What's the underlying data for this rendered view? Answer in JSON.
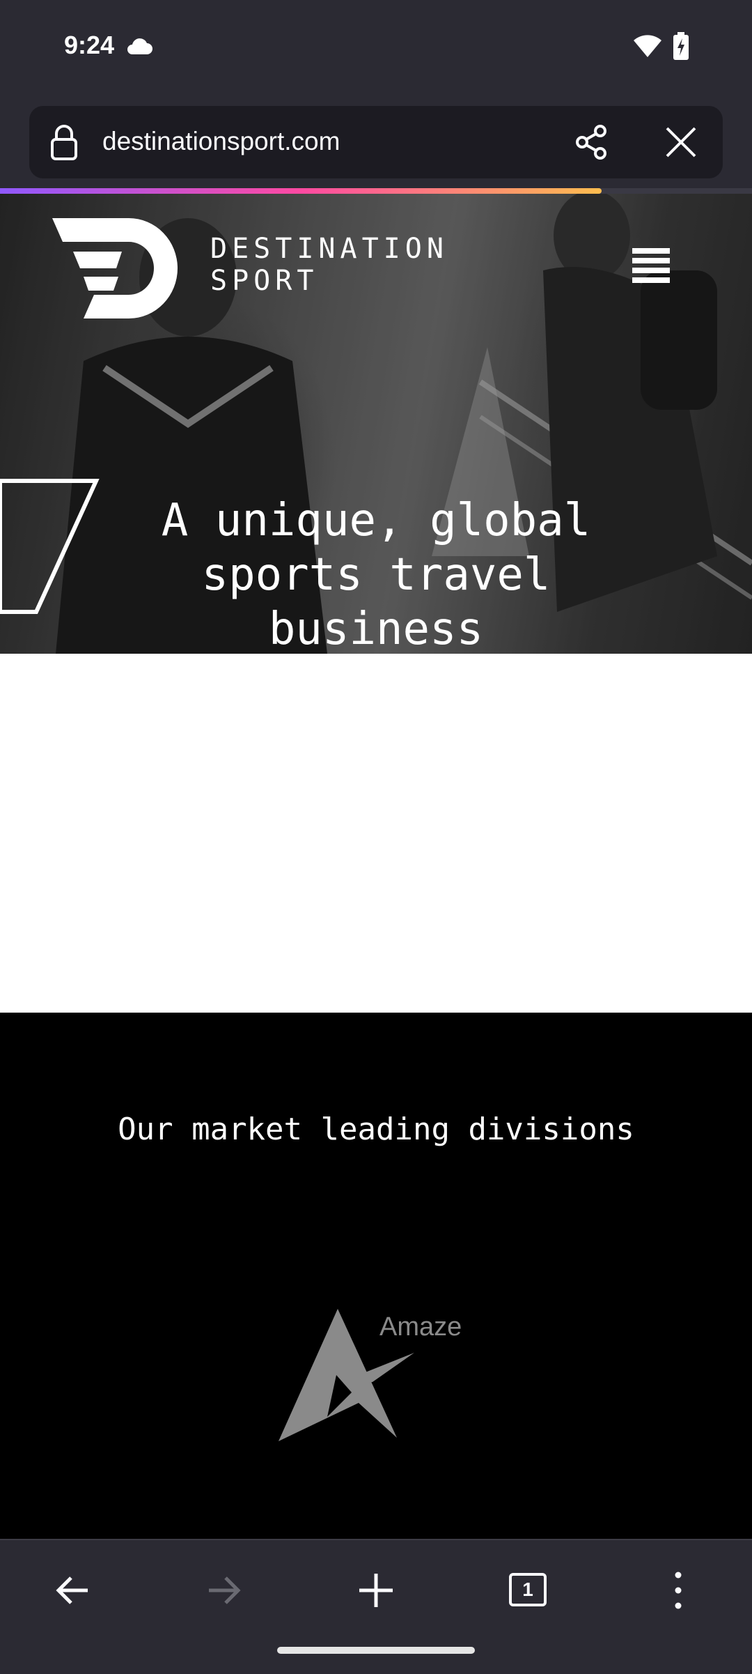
{
  "status_bar": {
    "time": "9:24",
    "icons": [
      "cloud-icon",
      "wifi-icon",
      "battery-charging-icon"
    ]
  },
  "browser": {
    "url": "destinationsport.com",
    "load_progress": 0.8,
    "icons": [
      "lock-icon",
      "share-icon",
      "close-icon"
    ],
    "accent_gradient": [
      "#9059ff",
      "#ff4aa2",
      "#ffbd4f"
    ]
  },
  "site": {
    "brand_line1": "DESTINATION",
    "brand_line2": "SPORT",
    "hero_title": "A unique, global sports travel business",
    "divisions_title": "Our market leading divisions",
    "division_logo_label": "Amaze"
  },
  "toolbar": {
    "tab_count": "1",
    "buttons": [
      "back",
      "forward",
      "new-tab",
      "tabs",
      "menu"
    ]
  }
}
